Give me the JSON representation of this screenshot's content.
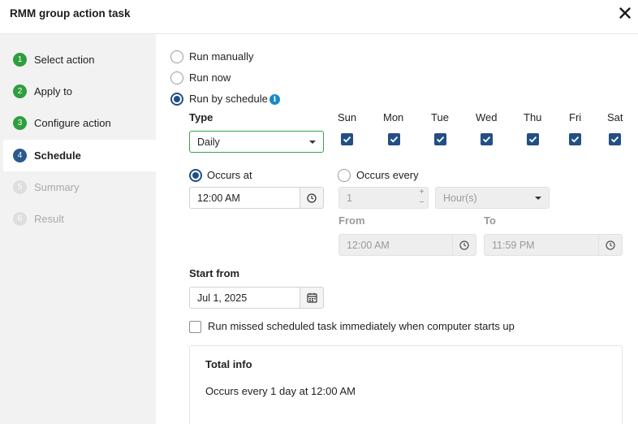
{
  "header": {
    "title": "RMM group action task"
  },
  "steps": [
    {
      "number": "1",
      "label": "Select action",
      "state": "done"
    },
    {
      "number": "2",
      "label": "Apply to",
      "state": "done"
    },
    {
      "number": "3",
      "label": "Configure action",
      "state": "done"
    },
    {
      "number": "4",
      "label": "Schedule",
      "state": "current"
    },
    {
      "number": "5",
      "label": "Summary",
      "state": "pending"
    },
    {
      "number": "6",
      "label": "Result",
      "state": "pending"
    }
  ],
  "run_options": {
    "manual": "Run manually",
    "now": "Run now",
    "schedule": "Run by schedule",
    "selected": "schedule"
  },
  "type": {
    "label": "Type",
    "value": "Daily"
  },
  "days": [
    {
      "label": "Sun",
      "checked": true
    },
    {
      "label": "Mon",
      "checked": true
    },
    {
      "label": "Tue",
      "checked": true
    },
    {
      "label": "Wed",
      "checked": true
    },
    {
      "label": "Thu",
      "checked": true
    },
    {
      "label": "Fri",
      "checked": true
    },
    {
      "label": "Sat",
      "checked": true
    }
  ],
  "occurs_at": {
    "label": "Occurs at",
    "time": "12:00 AM",
    "selected": true
  },
  "occurs_every": {
    "label": "Occurs every",
    "interval": "1",
    "unit": "Hour(s)",
    "from_label": "From",
    "from_time": "12:00 AM",
    "to_label": "To",
    "to_time": "11:59 PM",
    "plus": "+",
    "minus": "−"
  },
  "start_from": {
    "label": "Start from",
    "date": "Jul 1, 2025"
  },
  "missed_task": {
    "label": "Run missed scheduled task immediately when computer starts up",
    "checked": false
  },
  "total_info": {
    "title": "Total info",
    "text": "Occurs every 1 day at 12:00 AM"
  },
  "colors": {
    "primary": "#1f4f86",
    "done": "#2e9e3e",
    "info": "#1b88c9",
    "select_border": "#33a34a"
  }
}
